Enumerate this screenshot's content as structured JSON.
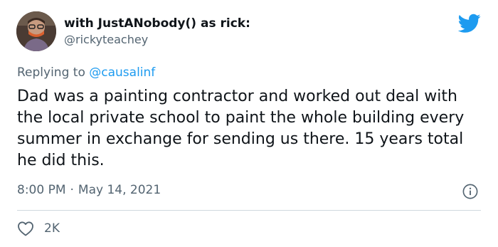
{
  "author": {
    "display_name": "with JustANobody() as rick:",
    "handle": "@rickyteachey"
  },
  "reply": {
    "prefix": "Replying to ",
    "mention": "@causalinf"
  },
  "tweet": {
    "text": "Dad was a painting contractor and worked out deal with the local private school to paint the whole building every summer in exchange for sending us there. 15 years total he did this.",
    "time": "8:00 PM",
    "separator": "·",
    "date": "May 14, 2021"
  },
  "engagement": {
    "like_count": "2K"
  },
  "icons": {
    "brand": "twitter-bird-icon",
    "info": "info-icon",
    "like": "heart-icon"
  },
  "colors": {
    "brand_blue": "#1d9bf0",
    "secondary_text": "#536471",
    "primary_text": "#0f1419",
    "divider": "#cfd9de"
  }
}
